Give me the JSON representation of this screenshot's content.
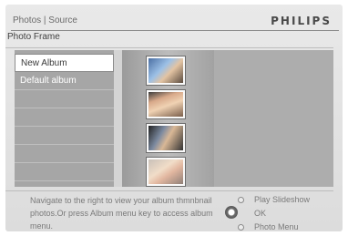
{
  "header": {
    "breadcrumb": "Photos | Source",
    "brand": "PHILIPS"
  },
  "subtitle": "Photo Frame",
  "albums": [
    {
      "label": "New Album",
      "selected": true
    },
    {
      "label": "Default album",
      "selected": false
    }
  ],
  "thumbnails": [
    {
      "icon": "group-photo-thumbnail"
    },
    {
      "icon": "family-photo-thumbnail"
    },
    {
      "icon": "group-photo-thumbnail"
    },
    {
      "icon": "baby-photo-thumbnail"
    }
  ],
  "help": {
    "line1": "Navigate to the right to view your album thmnbnail",
    "line2": "photos.Or press Album menu key to access album",
    "line3": "menu."
  },
  "controls": {
    "play_slideshow": "Play Slideshow",
    "ok": "OK",
    "photo_menu": "Photo Menu"
  }
}
